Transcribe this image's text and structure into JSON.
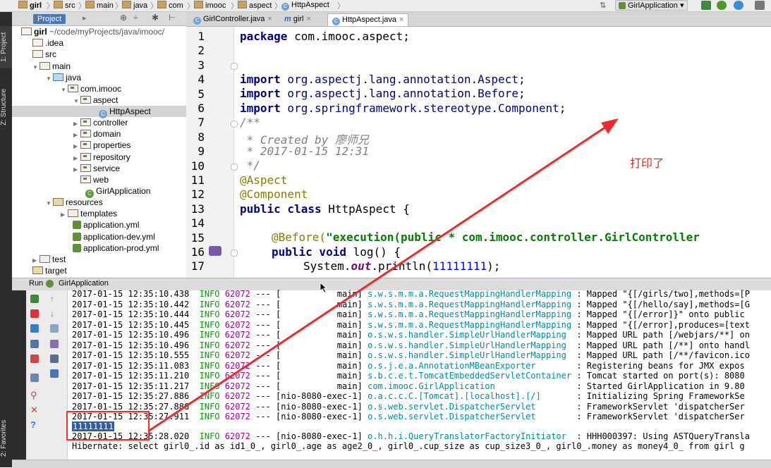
{
  "breadcrumb": [
    "girl",
    "src",
    "main",
    "java",
    "com",
    "imooc",
    "aspect",
    "HttpAspect"
  ],
  "run_config": "GirlApplication",
  "project_panel": {
    "title": "Project",
    "root_name": "girl",
    "root_path": "~/code/myProjects/java/imooc/",
    "items": [
      {
        "label": ".idea",
        "icon": "folder-icon"
      },
      {
        "label": "src",
        "icon": "folder-icon"
      },
      {
        "label": "main",
        "icon": "folder-icon"
      },
      {
        "label": "java",
        "icon": "source-folder-icon"
      },
      {
        "label": "com.imooc",
        "icon": "package-icon"
      },
      {
        "label": "aspect",
        "icon": "package-icon"
      },
      {
        "label": "HttpAspect",
        "icon": "class-icon"
      },
      {
        "label": "controller",
        "icon": "package-icon"
      },
      {
        "label": "domain",
        "icon": "package-icon"
      },
      {
        "label": "properties",
        "icon": "package-icon"
      },
      {
        "label": "repository",
        "icon": "package-icon"
      },
      {
        "label": "service",
        "icon": "package-icon"
      },
      {
        "label": "web",
        "icon": "package-icon"
      },
      {
        "label": "GirlApplication",
        "icon": "spring-class-icon"
      },
      {
        "label": "resources",
        "icon": "resources-folder-icon"
      },
      {
        "label": "templates",
        "icon": "folder-icon"
      },
      {
        "label": "application.yml",
        "icon": "yaml-file-icon"
      },
      {
        "label": "application-dev.yml",
        "icon": "yaml-file-icon"
      },
      {
        "label": "application-prod.yml",
        "icon": "yaml-file-icon"
      },
      {
        "label": "test",
        "icon": "folder-icon"
      },
      {
        "label": "target",
        "icon": "folder-icon"
      }
    ]
  },
  "side_tabs": {
    "project": "1: Project",
    "structure": "Z: Structure",
    "favorites": "2: Favorites"
  },
  "editor_tabs": [
    {
      "label": "GirlController.java",
      "icon": "C",
      "close": "×"
    },
    {
      "label": "girl",
      "icon": "m",
      "close": "×"
    },
    {
      "label": "HttpAspect.java",
      "icon": "C",
      "close": "×"
    }
  ],
  "editor": {
    "line_numbers": [
      "1",
      "2",
      "3",
      "4",
      "5",
      "6",
      "7",
      "8",
      "9",
      "10",
      "11",
      "12",
      "13",
      "14",
      "15",
      "16",
      "17"
    ],
    "lines": {
      "l1_kw": "package",
      "l1_rest": " com.imooc.aspect;",
      "l3_kw": "import",
      "l3_pkg": " org.aspectj.lang.annotation.Aspect",
      "l3_end": ";",
      "l4_kw": "import",
      "l4_pkg": " org.aspectj.lang.annotation.Before",
      "l4_end": ";",
      "l5_kw": "import",
      "l5_pkg": " org.springframework.stereotype.Component",
      "l5_end": ";",
      "l7": "/**",
      "l8": " * Created by 廖师兄",
      "l9": " * 2017-01-15 12:31",
      "l10": " */",
      "l11": "@Aspect",
      "l12": "@Component",
      "l13_kw": "public class",
      "l13_rest": " HttpAspect {",
      "l15_ann": "@Before(",
      "l15_str": "\"execution(public * com.imooc.controller.GirlController",
      "l16_kw": "public void",
      "l16_rest": " log() {",
      "l17_a": "System.",
      "l17_out": "out",
      "l17_b": ".println(",
      "l17_num": "11111111",
      "l17_c": ");"
    }
  },
  "run_panel": {
    "title": "Run",
    "config": "GirlApplication"
  },
  "console_lines": [
    {
      "ts": "2017-01-15 12:35:10.438",
      "lvl": "INFO",
      "pid": "62072",
      "dash": "---",
      "thread": "[           main]",
      "logger": "s.w.s.m.m.a.RequestMappingHandlerMapping",
      "msg": " : Mapped \"{[/girls/two],methods=[P"
    },
    {
      "ts": "2017-01-15 12:35:10.442",
      "lvl": "INFO",
      "pid": "62072",
      "dash": "---",
      "thread": "[           main]",
      "logger": "s.w.s.m.m.a.RequestMappingHandlerMapping",
      "msg": " : Mapped \"{[/hello/say],methods=[G"
    },
    {
      "ts": "2017-01-15 12:35:10.444",
      "lvl": "INFO",
      "pid": "62072",
      "dash": "---",
      "thread": "[           main]",
      "logger": "s.w.s.m.m.a.RequestMappingHandlerMapping",
      "msg": " : Mapped \"{[/error]}\" onto public"
    },
    {
      "ts": "2017-01-15 12:35:10.445",
      "lvl": "INFO",
      "pid": "62072",
      "dash": "---",
      "thread": "[           main]",
      "logger": "s.w.s.m.m.a.RequestMappingHandlerMapping",
      "msg": " : Mapped \"{[/error],produces=[text"
    },
    {
      "ts": "2017-01-15 12:35:10.496",
      "lvl": "INFO",
      "pid": "62072",
      "dash": "---",
      "thread": "[           main]",
      "logger": "o.s.w.s.handler.SimpleUrlHandlerMapping ",
      "msg": " : Mapped URL path [/webjars/**] on"
    },
    {
      "ts": "2017-01-15 12:35:10.496",
      "lvl": "INFO",
      "pid": "62072",
      "dash": "---",
      "thread": "[           main]",
      "logger": "o.s.w.s.handler.SimpleUrlHandlerMapping ",
      "msg": " : Mapped URL path [/**] onto handl"
    },
    {
      "ts": "2017-01-15 12:35:10.555",
      "lvl": "INFO",
      "pid": "62072",
      "dash": "---",
      "thread": "[           main]",
      "logger": "o.s.w.s.handler.SimpleUrlHandlerMapping ",
      "msg": " : Mapped URL path [/**/favicon.ico"
    },
    {
      "ts": "2017-01-15 12:35:11.083",
      "lvl": "INFO",
      "pid": "62072",
      "dash": "---",
      "thread": "[           main]",
      "logger": "o.s.j.e.a.AnnotationMBeanExporter       ",
      "msg": " : Registering beans for JMX expos"
    },
    {
      "ts": "2017-01-15 12:35:11.210",
      "lvl": "INFO",
      "pid": "62072",
      "dash": "---",
      "thread": "[           main]",
      "logger": "s.b.c.e.t.TomcatEmbeddedServletContainer",
      "msg": " : Tomcat started on port(s): 8080"
    },
    {
      "ts": "2017-01-15 12:35:11.217",
      "lvl": "INFO",
      "pid": "62072",
      "dash": "---",
      "thread": "[           main]",
      "logger": "com.imooc.GirlApplication               ",
      "msg": " : Started GirlApplication in 9.80"
    },
    {
      "ts": "2017-01-15 12:35:27.886",
      "lvl": "INFO",
      "pid": "62072",
      "dash": "---",
      "thread": "[nio-8080-exec-1]",
      "logger": "o.a.c.c.C.[Tomcat].[localhost].[/]      ",
      "msg": " : Initializing Spring FrameworkSe"
    },
    {
      "ts": "2017-01-15 12:35:27.886",
      "lvl": "INFO",
      "pid": "62072",
      "dash": "---",
      "thread": "[nio-8080-exec-1]",
      "logger": "o.s.web.servlet.DispatcherServlet       ",
      "msg": " : FrameworkServlet 'dispatcherSer"
    },
    {
      "ts": "2017-01-15 12:35:27.911",
      "lvl": "INFO",
      "pid": "62072",
      "dash": "---",
      "thread": "[nio-8080-exec-1]",
      "logger": "o.s.web.servlet.DispatcherServlet       ",
      "msg": " : FrameworkServlet 'dispatcherSer"
    }
  ],
  "console_output": "11111111",
  "console_last": {
    "ts": "2017-01-15 12:35:28.020",
    "lvl": "INFO",
    "pid": "62072",
    "dash": "---",
    "thread": "[nio-8080-exec-1]",
    "logger": "o.h.h.i.QueryTranslatorFactoryInitiator ",
    "msg": " : HHH000397: Using ASTQueryTransla"
  },
  "console_hibernate": "Hibernate: select girl0_.id as id1_0_, girl0_.age as age2_0_, girl0_.cup_size as cup_size3_0_, girl0_.money as money4_0_ from girl g",
  "annotation": "打印了",
  "colors": {
    "annotation_red": "#e3251c",
    "box_red": "#ff2a2a"
  }
}
